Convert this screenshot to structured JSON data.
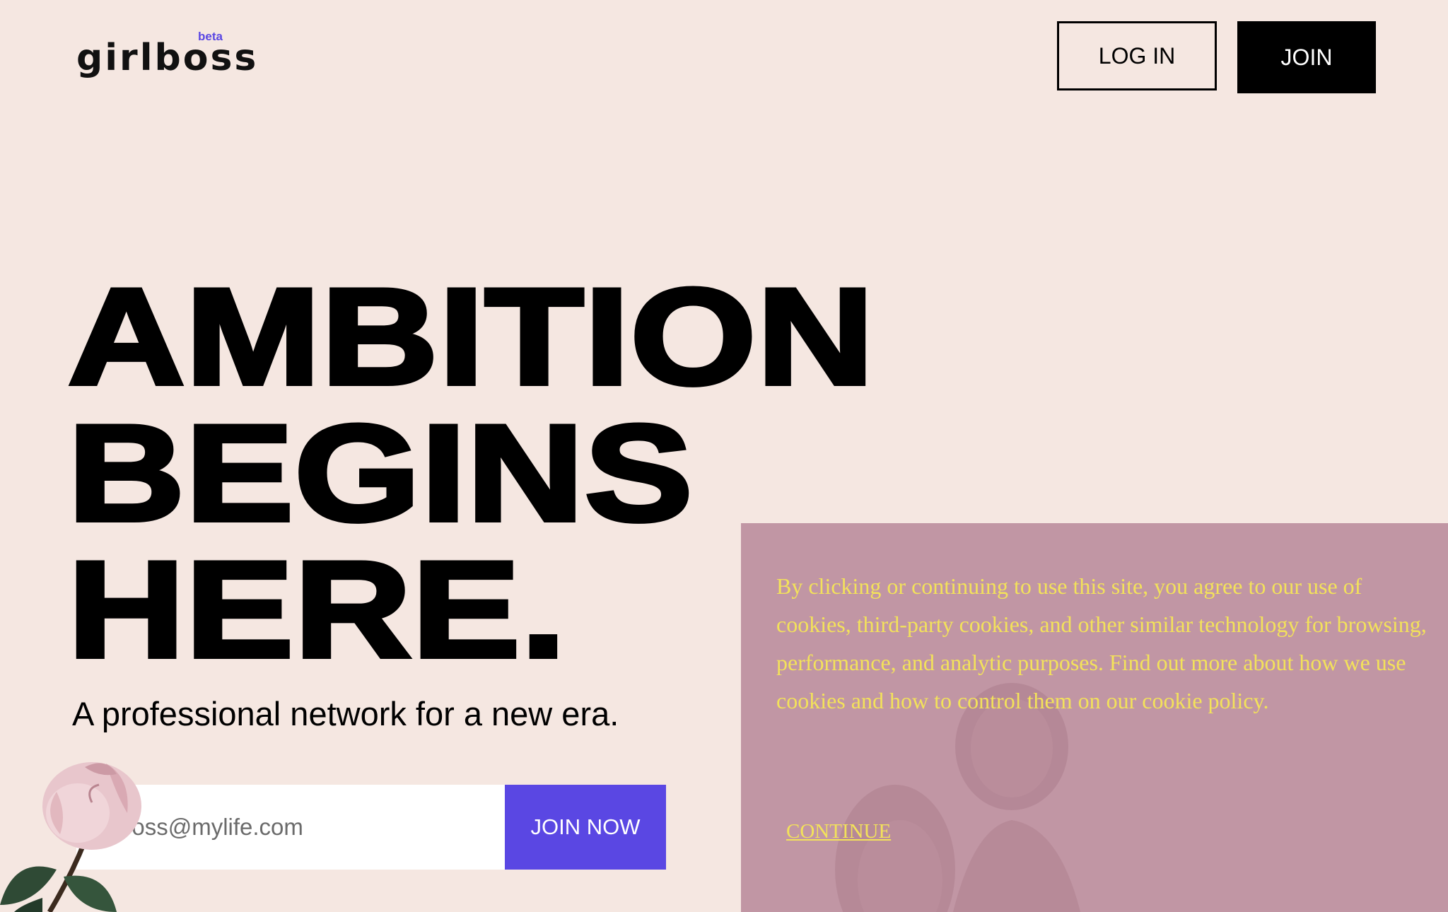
{
  "header": {
    "logo_text": "girlboss",
    "logo_badge": "beta",
    "login_label": "LOG IN",
    "join_label": "JOIN"
  },
  "hero": {
    "title_lines": [
      "AMBITION",
      "BEGINS",
      "HERE."
    ],
    "tagline": "A professional network for a new era."
  },
  "signup": {
    "email_placeholder": "boss@mylife.com",
    "submit_label": "JOIN NOW"
  },
  "cookie_banner": {
    "message": "By clicking or continuing to use this site, you agree to our use of cookies, third-party cookies, and other similar technology for browsing, performance, and analytic purposes. Find out more about how we use cookies and how to control them on our cookie policy.",
    "continue_label": "CONTINUE"
  },
  "colors": {
    "background": "#f5e7e1",
    "accent": "#5a47e3",
    "cookie_bg": "#c196a4",
    "cookie_text": "#f3e25a"
  },
  "icons": {
    "decoration": "rose-illustration"
  }
}
